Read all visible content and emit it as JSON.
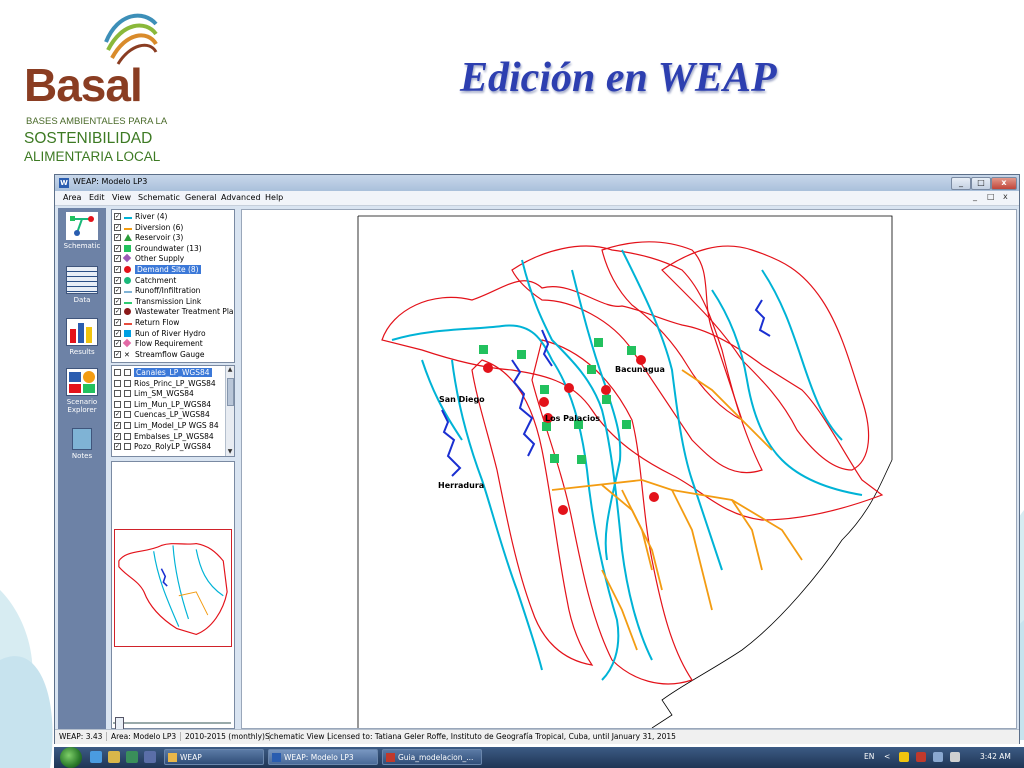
{
  "logo": {
    "word": "Basal",
    "line1": "BASES AMBIENTALES PARA LA",
    "line2": "SOSTENIBILIDAD",
    "line3": "ALIMENTARIA LOCAL"
  },
  "slide_title": "Edición en WEAP",
  "window": {
    "title": "WEAP: Modelo LP3",
    "controls": {
      "minimize": "_",
      "maximize": "□",
      "close": "x"
    }
  },
  "menu": [
    "Area",
    "Edit",
    "View",
    "Schematic",
    "General",
    "Advanced",
    "Help"
  ],
  "menu_controls": {
    "minimize": "_",
    "restore": "□",
    "close": "x"
  },
  "viewbar": [
    {
      "label": "Schematic",
      "icon": "schematic-icon"
    },
    {
      "label": "Data",
      "icon": "data-icon"
    },
    {
      "label": "Results",
      "icon": "results-icon"
    },
    {
      "label": "Scenario Explorer",
      "icon": "scenario-explorer-icon"
    },
    {
      "label": "Notes",
      "icon": "notes-icon"
    }
  ],
  "legend": [
    {
      "label": "River (4)",
      "checked": true,
      "color": "#00b3d6",
      "icon": "line"
    },
    {
      "label": "Diversion (6)",
      "checked": true,
      "color": "#f39c12",
      "icon": "line"
    },
    {
      "label": "Reservoir (3)",
      "checked": true,
      "color": "#2a9d3a",
      "icon": "triangle"
    },
    {
      "label": "Groundwater (13)",
      "checked": true,
      "color": "#22c15e",
      "icon": "square"
    },
    {
      "label": "Other Supply",
      "checked": true,
      "color": "#9b59b6",
      "icon": "diamond"
    },
    {
      "label": "Demand Site (8)",
      "checked": true,
      "color": "#e3121a",
      "icon": "circle",
      "selected": true
    },
    {
      "label": "Catchment",
      "checked": true,
      "color": "#1ab87a",
      "icon": "circle"
    },
    {
      "label": "Runoff/Infiltration",
      "checked": true,
      "color": "#7fb3d5",
      "icon": "dash"
    },
    {
      "label": "Transmission Link",
      "checked": true,
      "color": "#2ecc71",
      "icon": "line"
    },
    {
      "label": "Wastewater Treatment Plant",
      "checked": true,
      "color": "#8b1a1a",
      "icon": "circle"
    },
    {
      "label": "Return Flow",
      "checked": true,
      "color": "#e74c3c",
      "icon": "line"
    },
    {
      "label": "Run of River Hydro",
      "checked": true,
      "color": "#00a0e3",
      "icon": "square"
    },
    {
      "label": "Flow Requirement",
      "checked": true,
      "color": "#e36aa6",
      "icon": "diamond"
    },
    {
      "label": "Streamflow Gauge",
      "checked": true,
      "color": "#000000",
      "icon": "cross"
    }
  ],
  "layers": [
    {
      "label": "Canales_LP_WGS84",
      "checked": false,
      "selected": true
    },
    {
      "label": "Rios_Princ_LP_WGS84",
      "checked": false
    },
    {
      "label": "Lim_SM_WGS84",
      "checked": false
    },
    {
      "label": "Lim_Mun_LP_WGS84",
      "checked": false
    },
    {
      "label": "Cuencas_LP_WGS84",
      "checked": true
    },
    {
      "label": "Lim_Model_LP WGS 84",
      "checked": true
    },
    {
      "label": "Embalses_LP_WGS84",
      "checked": true
    },
    {
      "label": "Pozo_RolyLP_WGS84",
      "checked": true
    }
  ],
  "map_labels": {
    "san_diego": "San Diego",
    "herradura": "Herradura",
    "los_palacios": "Los Palacios",
    "bacunagua": "Bacunagua"
  },
  "status": {
    "version": "WEAP: 3.43",
    "area": "Area: Modelo LP3",
    "period": "2010-2015 (monthly)",
    "view": "Schematic View",
    "license": "Licensed to: Tatiana Geler Roffe, Instituto de Geografía Tropical, Cuba, until January 31, 2015"
  },
  "taskbar": {
    "tasks": [
      "WEAP",
      "WEAP: Modelo LP3",
      "Guia_modelacion_..."
    ],
    "lang": "EN",
    "time": "3:42 AM"
  },
  "colors": {
    "basin_border": "#e3121a",
    "river": "#00b3d6",
    "diversion": "#f39c12",
    "reservoir": "#1a2fd1",
    "groundwater": "#22c15e",
    "demand": "#e3121a",
    "title": "#2d3fb0"
  }
}
